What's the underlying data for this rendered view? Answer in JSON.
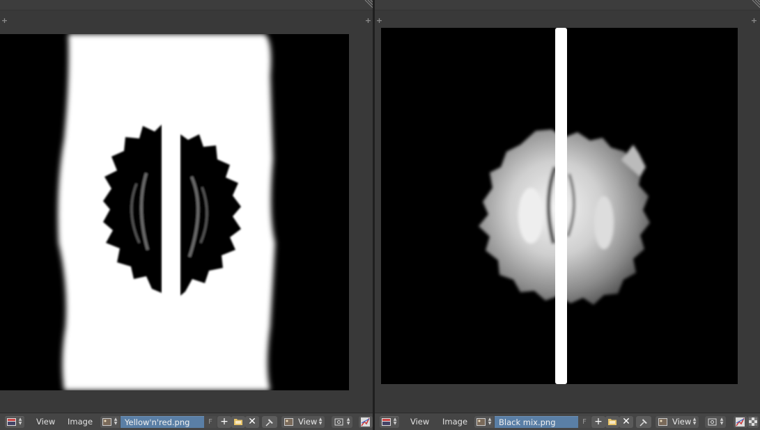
{
  "colors": {
    "editor_bg": "#393939",
    "footer_bg": "#454545",
    "field_highlight": "#5a7fa6",
    "viewport_bg": "#000000"
  },
  "left_editor": {
    "menu": {
      "view": "View",
      "image": "Image"
    },
    "image_name": "Yellow'n'red.png",
    "fake_user_label": "F",
    "view_selector": "View",
    "icons": {
      "editor_type": "image-editor-icon",
      "browse": "image-browse-icon",
      "new": "plus-icon",
      "open": "folder-icon",
      "unlink": "close-icon",
      "pin": "pin-icon",
      "view_mode": "image-view-icon",
      "pivot": "pivot-icon",
      "render_slot": "histogram-icon"
    }
  },
  "right_editor": {
    "menu": {
      "view": "View",
      "image": "Image"
    },
    "image_name": "Black mix.png",
    "fake_user_label": "F",
    "view_selector": "View",
    "icons": {
      "editor_type": "image-editor-icon",
      "browse": "image-browse-icon",
      "new": "plus-icon",
      "open": "folder-icon",
      "unlink": "close-icon",
      "pin": "pin-icon",
      "view_mode": "image-view-icon",
      "pivot": "pivot-icon",
      "alpha": "checker-icon"
    }
  }
}
